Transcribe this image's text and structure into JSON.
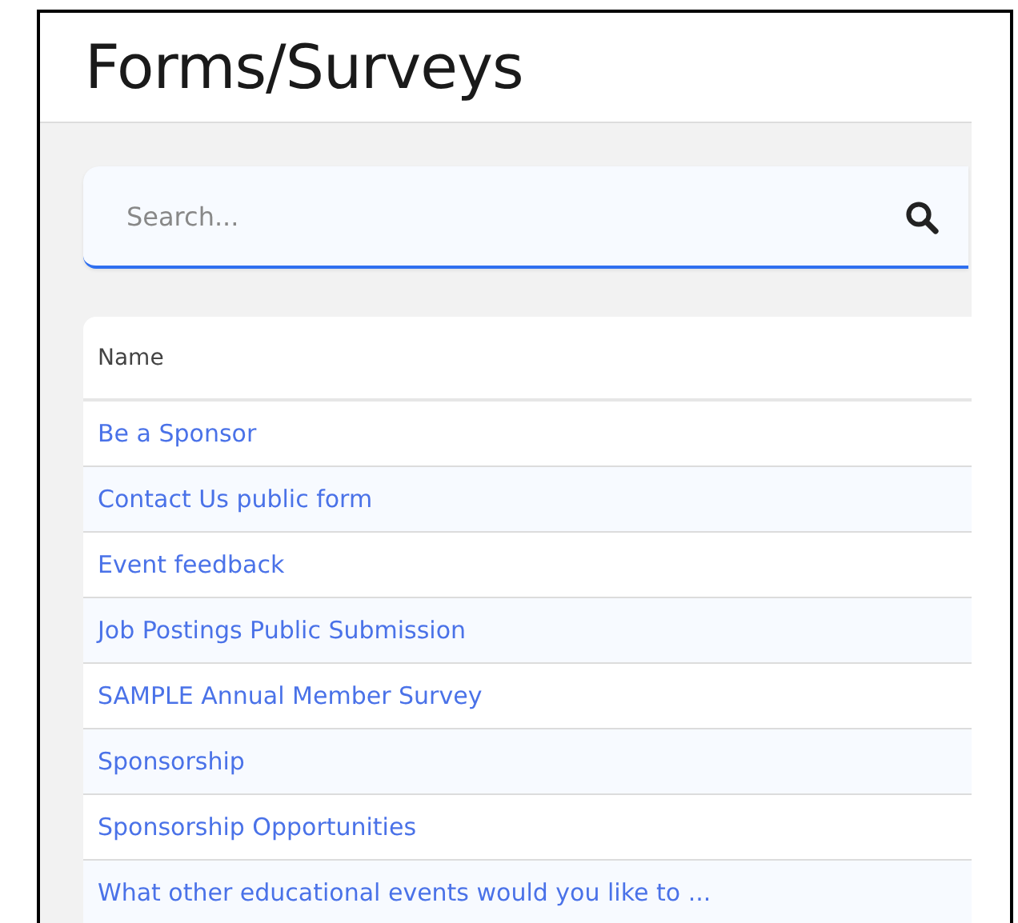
{
  "page": {
    "title": "Forms/Surveys"
  },
  "search": {
    "placeholder": "Search..."
  },
  "table": {
    "columns": [
      "Name"
    ],
    "rows": [
      "Be a Sponsor",
      "Contact Us public form",
      "Event feedback",
      "Job Postings Public Submission",
      "SAMPLE Annual Member Survey",
      "Sponsorship",
      "Sponsorship Opportunities",
      "What other educational events would you like to ..."
    ]
  }
}
